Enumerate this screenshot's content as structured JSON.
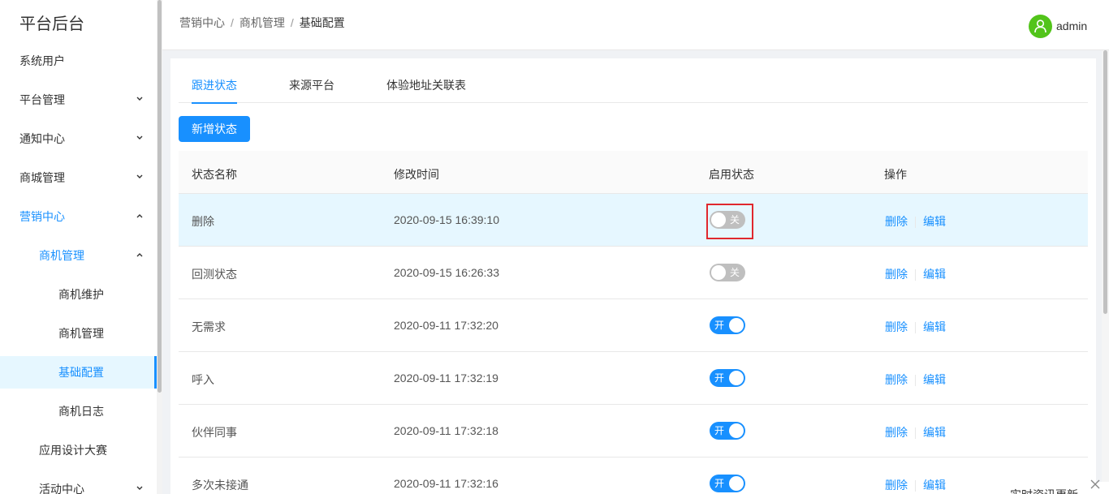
{
  "app": {
    "title": "平台后台"
  },
  "sidebar": {
    "items": [
      {
        "label": "系统用户"
      },
      {
        "label": "平台管理"
      },
      {
        "label": "通知中心"
      },
      {
        "label": "商城管理"
      },
      {
        "label": "营销中心"
      },
      {
        "label": "商机管理"
      },
      {
        "label": "商机维护"
      },
      {
        "label": "商机管理"
      },
      {
        "label": "基础配置"
      },
      {
        "label": "商机日志"
      },
      {
        "label": "应用设计大赛"
      },
      {
        "label": "活动中心"
      }
    ]
  },
  "header": {
    "breadcrumb": [
      "营销中心",
      "商机管理",
      "基础配置"
    ],
    "separator": "/",
    "username": "admin"
  },
  "tabs": [
    {
      "label": "跟进状态",
      "active": true
    },
    {
      "label": "来源平台",
      "active": false
    },
    {
      "label": "体验地址关联表",
      "active": false
    }
  ],
  "toolbar": {
    "add_label": "新增状态"
  },
  "table": {
    "columns": [
      "状态名称",
      "修改时间",
      "启用状态",
      "操作"
    ],
    "rows": [
      {
        "name": "删除",
        "time": "2020-09-15 16:39:10",
        "enabled": false,
        "switch_text": "关"
      },
      {
        "name": "回测状态",
        "time": "2020-09-15 16:26:33",
        "enabled": false,
        "switch_text": "关"
      },
      {
        "name": "无需求",
        "time": "2020-09-11 17:32:20",
        "enabled": true,
        "switch_text": "开"
      },
      {
        "name": "呼入",
        "time": "2020-09-11 17:32:19",
        "enabled": true,
        "switch_text": "开"
      },
      {
        "name": "伙伴同事",
        "time": "2020-09-11 17:32:18",
        "enabled": true,
        "switch_text": "开"
      },
      {
        "name": "多次未接通",
        "time": "2020-09-11 17:32:16",
        "enabled": true,
        "switch_text": "开"
      }
    ],
    "actions": {
      "delete": "删除",
      "edit": "编辑"
    }
  },
  "notice": {
    "text": "实时资讯更新"
  },
  "colors": {
    "accent": "#1890ff",
    "success": "#52c41a",
    "highlight": "#e0282e"
  }
}
